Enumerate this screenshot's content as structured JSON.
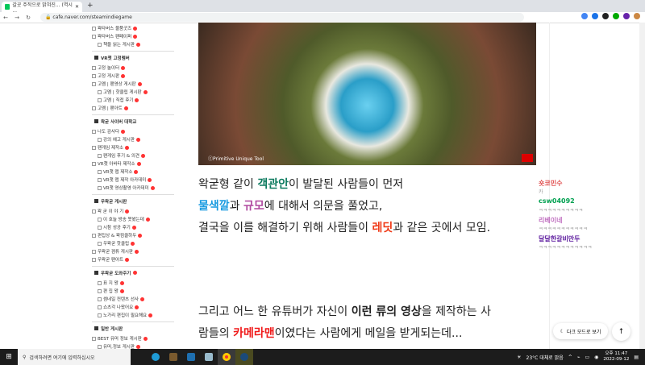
{
  "browser": {
    "tab_title": "갈곳 주작으로 밝혀진... (역시 ...",
    "url": "cafe.naver.com/steamindiegame"
  },
  "sidebar": {
    "items": [
      {
        "label": "왁타버스 물품굿즈",
        "t": "it"
      },
      {
        "label": "왁타버스 팬페이퍼",
        "t": "it"
      },
      {
        "label": "책을 읽는 게시판",
        "t": "sub"
      },
      {
        "label": "VR챗 고정멤버",
        "t": "hd"
      },
      {
        "label": "고정 놀이터",
        "t": "it"
      },
      {
        "label": "고정 게시판",
        "t": "it"
      },
      {
        "label": "고멤 | 팬영상 게시판",
        "t": "it"
      },
      {
        "label": "고멤 | 핫클립 게시판",
        "t": "sub"
      },
      {
        "label": "고멤 | 직접 후기",
        "t": "sub"
      },
      {
        "label": "고멤 | 팬아트",
        "t": "it"
      },
      {
        "label": "왁굳 사이버 대학교",
        "t": "hd"
      },
      {
        "label": "나도 감사다",
        "t": "it"
      },
      {
        "label": "강의 예고 게시판",
        "t": "sub"
      },
      {
        "label": "팬게임 제작소",
        "t": "it"
      },
      {
        "label": "팬게임 후기 & 의견",
        "t": "sub"
      },
      {
        "label": "VR챗 아바타 제작소",
        "t": "it"
      },
      {
        "label": "VR챗 맵 제작소",
        "t": "sub"
      },
      {
        "label": "VR챗 맵 제작 아카데미",
        "t": "sub"
      },
      {
        "label": "VR챗 영상촬영 아카데미",
        "t": "sub"
      },
      {
        "label": "우왁굳 게시판",
        "t": "hd"
      },
      {
        "label": "왁 굳 이 야 기",
        "t": "it"
      },
      {
        "label": "이 호늘 방송 못봤는데",
        "t": "sub"
      },
      {
        "label": "시참 성공 후기",
        "t": "sub"
      },
      {
        "label": "편집상 & 왁컴클하두",
        "t": "it"
      },
      {
        "label": "우왁굳 핫클립",
        "t": "sub"
      },
      {
        "label": "우왁굳 겜튜 게시판",
        "t": "it"
      },
      {
        "label": "우왁굳 팬아트",
        "t": "it"
      },
      {
        "label": "우왁굳 도와주기",
        "t": "hd"
      },
      {
        "label": "표 지 왕",
        "t": "sub"
      },
      {
        "label": "편 집 왕",
        "t": "sub"
      },
      {
        "label": "썸네일 컨텐츠 선사",
        "t": "sub"
      },
      {
        "label": "쇼츠각 나왔어요",
        "t": "sub"
      },
      {
        "label": "노가리 편집이 필요해요",
        "t": "sub"
      },
      {
        "label": "일반 게시판",
        "t": "hd"
      },
      {
        "label": "BEST 유머 정보 게시판",
        "t": "it"
      },
      {
        "label": "유머,정보 게시판",
        "t": "sub"
      }
    ]
  },
  "video": {
    "caption": "ⓒPrimitive Unique Tool"
  },
  "article": {
    "l1": [
      "왁굳형 같이 ",
      "객관안",
      "이 발달된 사람들이 먼저"
    ],
    "l2": [
      "물색깔",
      "과 ",
      "규모",
      "에 대해서 의문을 풀었고,"
    ],
    "l3": [
      "결국을 이를 해결하기 위해 사람들이 ",
      "레딧",
      "과 같은 곳에서 모임."
    ],
    "l4": [
      "그리고 어느 한 유튜버가 자신이 ",
      "이런 류의 영상",
      "을 제작하는 사"
    ],
    "l5": [
      "람들의 ",
      "카메라맨",
      "이였다는 사람에게 메일을 받게되는데..."
    ]
  },
  "colors": {
    "teal": "#0b7a5e",
    "blue": "#1a9be0",
    "purple": "#b04aa0",
    "red": "#f03a17"
  },
  "chat": [
    {
      "user": "숏코민수",
      "msg": "카",
      "color": "#e05050"
    },
    {
      "user": "csw04092",
      "msg": "ㅋㅋㅋㅋㅋㅋㅋㅋㅋㅋ",
      "color": "#00a050"
    },
    {
      "user": "리베이네",
      "msg": "ㅋㅋㅋㅋㅋㅋㅋㅋㅋㅋㅋ",
      "color": "#c070c0"
    },
    {
      "user": "달달한갈비만두",
      "msg": "ㅋㅋㅋㅋㅋㅋㅋㅋㅋㅋㅋㅋ",
      "color": "#6020a0"
    }
  ],
  "buttons": {
    "dark_mode": "다크 모드로 보기",
    "top": "↑"
  },
  "taskbar": {
    "search_placeholder": "검색하려면 여기에 입력하십시오",
    "weather": "23°C 대체로 맑음",
    "time": "오후 11:47",
    "date": "2022-09-12"
  }
}
